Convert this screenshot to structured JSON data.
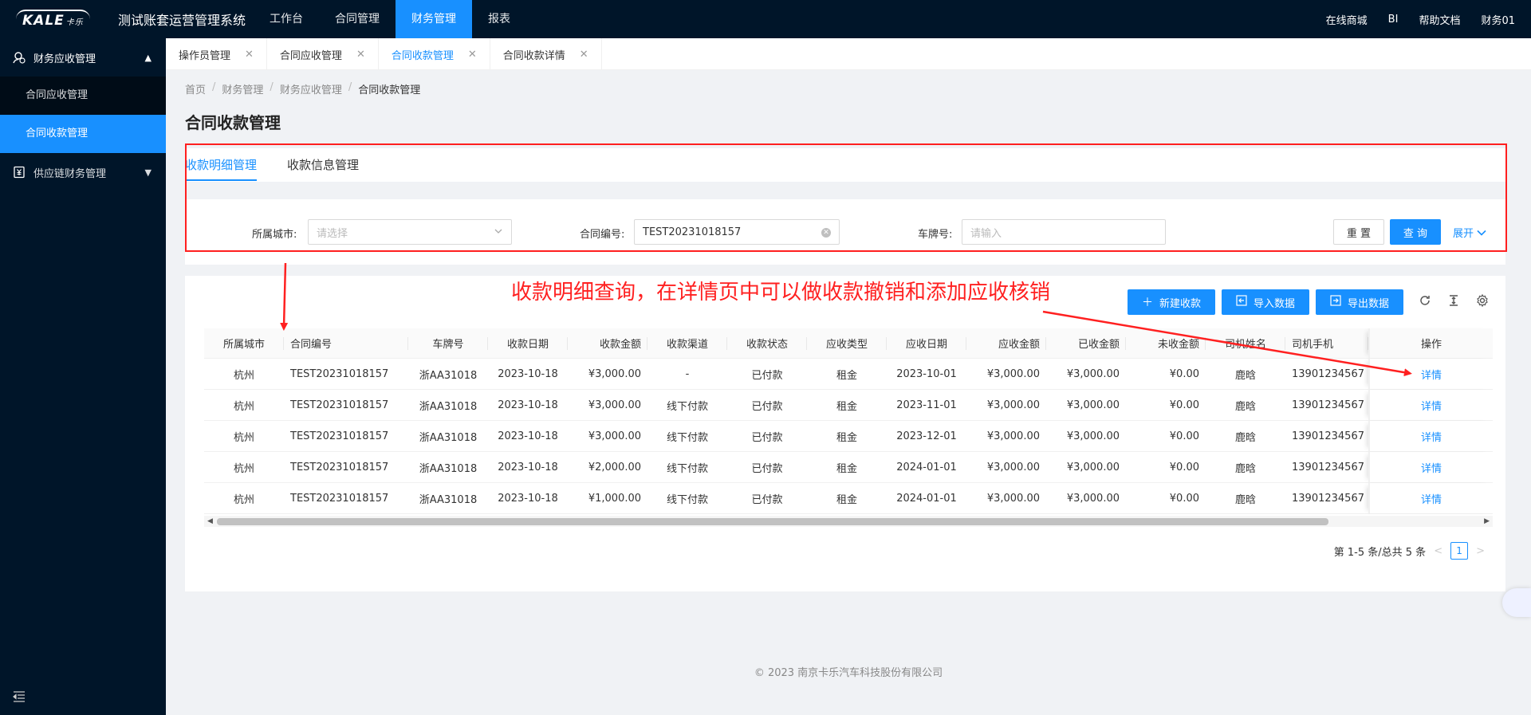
{
  "topbar": {
    "logo_text": "KALE",
    "logo_sub": "卡乐",
    "app_title": "测试账套运营管理系统",
    "nav": [
      {
        "label": "工作台",
        "active": false
      },
      {
        "label": "合同管理",
        "active": false
      },
      {
        "label": "财务管理",
        "active": true
      },
      {
        "label": "报表",
        "active": false
      }
    ],
    "right": {
      "mall": "在线商城",
      "bi": "BI",
      "help": "帮助文档",
      "user": "财务01"
    }
  },
  "sidebar": {
    "group1": {
      "label": "财务应收管理",
      "expanded": true
    },
    "group1_items": [
      {
        "label": "合同应收管理",
        "active": false
      },
      {
        "label": "合同收款管理",
        "active": true
      }
    ],
    "group2": {
      "label": "供应链财务管理",
      "expanded": false
    }
  },
  "tabs": [
    {
      "label": "操作员管理",
      "active": false
    },
    {
      "label": "合同应收管理",
      "active": false
    },
    {
      "label": "合同收款管理",
      "active": true
    },
    {
      "label": "合同收款详情",
      "active": false
    }
  ],
  "breadcrumb": [
    "首页",
    "财务管理",
    "财务应收管理",
    "合同收款管理"
  ],
  "page_title": "合同收款管理",
  "subtabs": [
    {
      "label": "收款明细管理",
      "active": true
    },
    {
      "label": "收款信息管理",
      "active": false
    }
  ],
  "filter": {
    "city_label": "所属城市:",
    "city_placeholder": "请选择",
    "contract_label": "合同编号:",
    "contract_value": "TEST20231018157",
    "plate_label": "车牌号:",
    "plate_placeholder": "请输入",
    "reset": "重 置",
    "query": "查 询",
    "expand": "展开"
  },
  "annotation": "收款明细查询，在详情页中可以做收款撤销和添加应收核销",
  "toolbar": {
    "new": "新建收款",
    "import": "导入数据",
    "export": "导出数据"
  },
  "table": {
    "columns": [
      "所属城市",
      "合同编号",
      "车牌号",
      "收款日期",
      "收款金额",
      "收款渠道",
      "收款状态",
      "应收类型",
      "应收日期",
      "应收金额",
      "已收金额",
      "未收金额",
      "司机姓名",
      "司机手机",
      "操作"
    ],
    "rows": [
      [
        "杭州",
        "TEST20231018157",
        "浙AA31018",
        "2023-10-18",
        "¥3,000.00",
        "-",
        "已付款",
        "租金",
        "2023-10-01",
        "¥3,000.00",
        "¥3,000.00",
        "¥0.00",
        "鹿晗",
        "13901234567",
        "详情"
      ],
      [
        "杭州",
        "TEST20231018157",
        "浙AA31018",
        "2023-10-18",
        "¥3,000.00",
        "线下付款",
        "已付款",
        "租金",
        "2023-11-01",
        "¥3,000.00",
        "¥3,000.00",
        "¥0.00",
        "鹿晗",
        "13901234567",
        "详情"
      ],
      [
        "杭州",
        "TEST20231018157",
        "浙AA31018",
        "2023-10-18",
        "¥3,000.00",
        "线下付款",
        "已付款",
        "租金",
        "2023-12-01",
        "¥3,000.00",
        "¥3,000.00",
        "¥0.00",
        "鹿晗",
        "13901234567",
        "详情"
      ],
      [
        "杭州",
        "TEST20231018157",
        "浙AA31018",
        "2023-10-18",
        "¥2,000.00",
        "线下付款",
        "已付款",
        "租金",
        "2024-01-01",
        "¥3,000.00",
        "¥3,000.00",
        "¥0.00",
        "鹿晗",
        "13901234567",
        "详情"
      ],
      [
        "杭州",
        "TEST20231018157",
        "浙AA31018",
        "2023-10-18",
        "¥1,000.00",
        "线下付款",
        "已付款",
        "租金",
        "2024-01-01",
        "¥3,000.00",
        "¥3,000.00",
        "¥0.00",
        "鹿晗",
        "13901234567",
        "详情"
      ]
    ]
  },
  "pagination": {
    "summary": "第 1-5 条/总共 5 条",
    "current": "1"
  },
  "footer": "© 2023 南京卡乐汽车科技股份有限公司",
  "colors": {
    "primary": "#1890ff",
    "sidebar_bg": "#001529",
    "annotation": "#ff2020"
  }
}
